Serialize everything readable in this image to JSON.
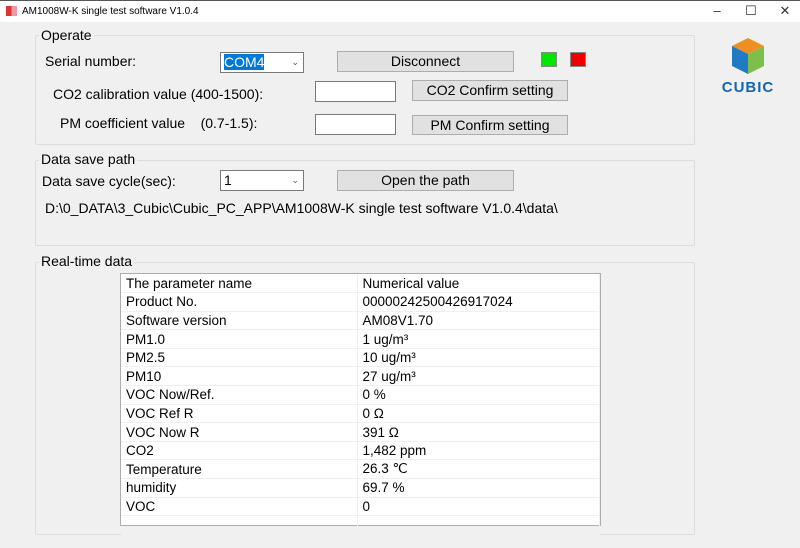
{
  "window": {
    "title": "AM1008W-K single test software V1.0.4",
    "minimize": "–",
    "maximize": "☐",
    "close": "✕"
  },
  "logo": {
    "text": "CUBIC"
  },
  "operate": {
    "title": "Operate",
    "serial_label": "Serial number:",
    "serial_value": "COM4",
    "disconnect": "Disconnect",
    "co2_label": "CO2 calibration value (400-1500):",
    "co2_value": "",
    "co2_button": "CO2 Confirm setting",
    "pm_label": "PM coefficient value    (0.7-1.5):",
    "pm_value": "",
    "pm_button": "PM  Confirm setting",
    "status_colors": [
      "#00e600",
      "#ee0000"
    ]
  },
  "save": {
    "title": "Data save path",
    "cycle_label": "Data save cycle(sec):",
    "cycle_value": "1",
    "open_button": "Open the path",
    "path": "D:\\0_DATA\\3_Cubic\\Cubic_PC_APP\\AM1008W-K single test software V1.0.4\\data\\"
  },
  "realtime": {
    "title": "Real-time data",
    "headers": [
      "The parameter name",
      "Numerical value"
    ],
    "rows": [
      [
        "Product No.",
        "00000242500426917024"
      ],
      [
        "Software version",
        "AM08V1.70"
      ],
      [
        "PM1.0",
        "1 ug/m³"
      ],
      [
        "PM2.5",
        "10 ug/m³"
      ],
      [
        "PM10",
        "27 ug/m³"
      ],
      [
        "VOC Now/Ref.",
        "0 %"
      ],
      [
        "VOC Ref R",
        "0 Ω"
      ],
      [
        "VOC Now R",
        "391 Ω"
      ],
      [
        "CO2",
        "1,482 ppm"
      ],
      [
        "Temperature",
        "26.3 ℃"
      ],
      [
        "humidity",
        "69.7 %"
      ],
      [
        "VOC",
        "0"
      ]
    ]
  }
}
